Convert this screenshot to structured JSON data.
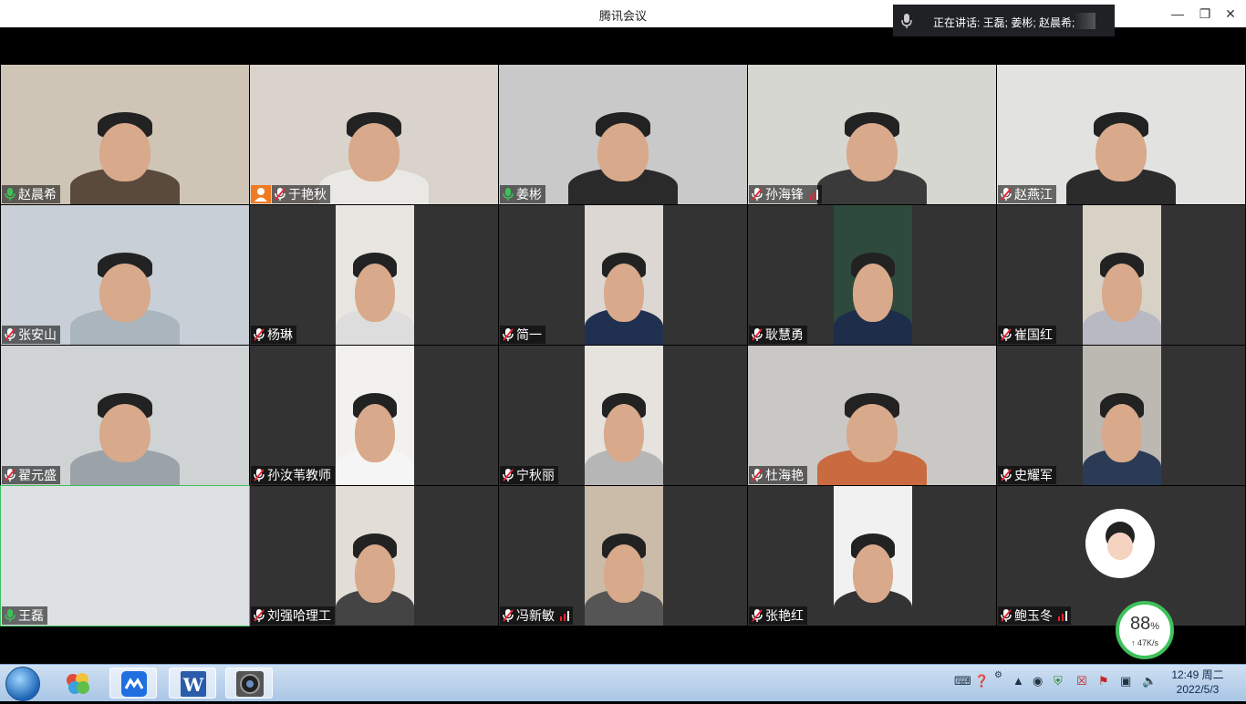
{
  "window": {
    "title": "腾讯会议"
  },
  "speaking": {
    "prefix": "正在讲话: ",
    "names": "王磊; 姜彬; 赵晨希;"
  },
  "tiles": [
    {
      "name": "赵晨希",
      "mic": "on"
    },
    {
      "name": "于艳秋",
      "mic": "muted",
      "host": true
    },
    {
      "name": "姜彬",
      "mic": "on"
    },
    {
      "name": "孙海锋",
      "mic": "muted",
      "signal": true
    },
    {
      "name": "赵燕江",
      "mic": "muted"
    },
    {
      "name": "张安山",
      "mic": "muted"
    },
    {
      "name": "杨琳",
      "mic": "muted"
    },
    {
      "name": "简一",
      "mic": "muted"
    },
    {
      "name": "耿慧勇",
      "mic": "muted"
    },
    {
      "name": "崔国红",
      "mic": "muted"
    },
    {
      "name": "翟元盛",
      "mic": "muted"
    },
    {
      "name": "孙汝苇教师",
      "mic": "muted"
    },
    {
      "name": "宁秋丽",
      "mic": "muted"
    },
    {
      "name": "杜海艳",
      "mic": "muted"
    },
    {
      "name": "史耀军",
      "mic": "muted"
    },
    {
      "name": "王磊",
      "mic": "on"
    },
    {
      "name": "刘强哈理工",
      "mic": "muted"
    },
    {
      "name": "冯新敏",
      "mic": "muted",
      "signal": true
    },
    {
      "name": "张艳红",
      "mic": "muted"
    },
    {
      "name": "鲍玉冬",
      "mic": "muted",
      "signal": true
    }
  ],
  "network": {
    "percent": "88",
    "percent_unit": "%",
    "speed": "47K/s"
  },
  "taskbar": {
    "apps": [
      "windows-start",
      "paint-app",
      "tencent-meeting",
      "word",
      "camera"
    ],
    "clock_time": "12:49 周二",
    "clock_date": "2022/5/3"
  },
  "colors": {
    "accent_green": "#3ec15a",
    "mic_muted": "#e23",
    "host_orange": "#f07a21"
  }
}
